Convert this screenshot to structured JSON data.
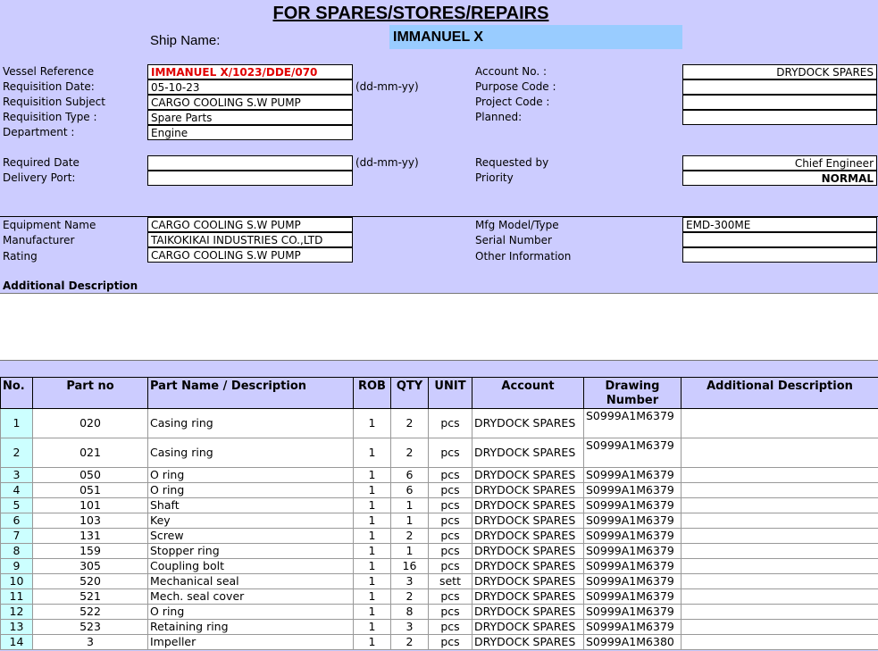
{
  "header": {
    "title": "FOR SPARES/STORES/REPAIRS",
    "ship_name_label": "Ship Name:",
    "ship_name": "IMMANUEL X"
  },
  "form": {
    "vessel_reference_label": "Vessel Reference",
    "vessel_reference": "IMMANUEL X/1023/DDE/070",
    "requisition_date_label": "Requisition Date:",
    "requisition_date": "05-10-23",
    "date_format_hint": "(dd-mm-yy)",
    "requisition_subject_label": "Requisition Subject",
    "requisition_subject": "CARGO COOLING S.W PUMP",
    "requisition_type_label": "Requisition Type :",
    "requisition_type": "Spare Parts",
    "department_label": "Department :",
    "department": "Engine",
    "account_no_label": "Account No. :",
    "account_no": "DRYDOCK SPARES",
    "purpose_code_label": "Purpose Code :",
    "purpose_code": "",
    "project_code_label": "Project Code :",
    "project_code": "",
    "planned_label": "Planned:",
    "planned": "",
    "required_date_label": "Required Date",
    "required_date": "",
    "required_date_hint": "(dd-mm-yy)",
    "delivery_port_label": "Delivery Port:",
    "delivery_port": "",
    "requested_by_label": "Requested by",
    "requested_by": "Chief Engineer",
    "priority_label": "Priority",
    "priority": "NORMAL"
  },
  "equipment": {
    "equipment_name_label": "Equipment Name",
    "equipment_name": "CARGO COOLING S.W PUMP",
    "manufacturer_label": "Manufacturer",
    "manufacturer": "TAIKOKIKAI INDUSTRIES CO.,LTD",
    "rating_label": "Rating",
    "rating": "CARGO COOLING S.W PUMP",
    "mfg_model_label": "Mfg Model/Type",
    "mfg_model": "EMD-300ME",
    "serial_number_label": "Serial Number",
    "serial_number": "",
    "other_information_label": "Other Information",
    "other_information": ""
  },
  "additional_description_label": "Additional Description",
  "additional_description": "",
  "table": {
    "headers": [
      "No.",
      "Part no",
      "Part Name / Description",
      "ROB",
      "QTY",
      "UNIT",
      "Account",
      "Drawing Number",
      "Additional Description"
    ],
    "rows": [
      {
        "no": "1",
        "part_no": "020",
        "name": "Casing ring",
        "rob": "1",
        "qty": "2",
        "unit": "pcs",
        "account": "DRYDOCK SPARES",
        "drawing": "S0999A1M6379",
        "desc": ""
      },
      {
        "no": "2",
        "part_no": "021",
        "name": "Casing ring",
        "rob": "1",
        "qty": "2",
        "unit": "pcs",
        "account": "DRYDOCK SPARES",
        "drawing": "S0999A1M6379",
        "desc": ""
      },
      {
        "no": "3",
        "part_no": "050",
        "name": "O ring",
        "rob": "1",
        "qty": "6",
        "unit": "pcs",
        "account": "DRYDOCK SPARES",
        "drawing": "S0999A1M6379",
        "desc": ""
      },
      {
        "no": "4",
        "part_no": "051",
        "name": "O ring",
        "rob": "1",
        "qty": "6",
        "unit": "pcs",
        "account": "DRYDOCK SPARES",
        "drawing": "S0999A1M6379",
        "desc": ""
      },
      {
        "no": "5",
        "part_no": "101",
        "name": "Shaft",
        "rob": "1",
        "qty": "1",
        "unit": "pcs",
        "account": "DRYDOCK SPARES",
        "drawing": "S0999A1M6379",
        "desc": ""
      },
      {
        "no": "6",
        "part_no": "103",
        "name": "Key",
        "rob": "1",
        "qty": "1",
        "unit": "pcs",
        "account": "DRYDOCK SPARES",
        "drawing": "S0999A1M6379",
        "desc": ""
      },
      {
        "no": "7",
        "part_no": "131",
        "name": "Screw",
        "rob": "1",
        "qty": "2",
        "unit": "pcs",
        "account": "DRYDOCK SPARES",
        "drawing": "S0999A1M6379",
        "desc": ""
      },
      {
        "no": "8",
        "part_no": "159",
        "name": "Stopper ring",
        "rob": "1",
        "qty": "1",
        "unit": "pcs",
        "account": "DRYDOCK SPARES",
        "drawing": "S0999A1M6379",
        "desc": ""
      },
      {
        "no": "9",
        "part_no": "305",
        "name": "Coupling bolt",
        "rob": "1",
        "qty": "16",
        "unit": "pcs",
        "account": "DRYDOCK SPARES",
        "drawing": "S0999A1M6379",
        "desc": ""
      },
      {
        "no": "10",
        "part_no": "520",
        "name": "Mechanical seal",
        "rob": "1",
        "qty": "3",
        "unit": "sett",
        "account": "DRYDOCK SPARES",
        "drawing": "S0999A1M6379",
        "desc": ""
      },
      {
        "no": "11",
        "part_no": "521",
        "name": "Mech. seal cover",
        "rob": "1",
        "qty": "2",
        "unit": "pcs",
        "account": "DRYDOCK SPARES",
        "drawing": "S0999A1M6379",
        "desc": ""
      },
      {
        "no": "12",
        "part_no": "522",
        "name": "O ring",
        "rob": "1",
        "qty": "8",
        "unit": "pcs",
        "account": "DRYDOCK SPARES",
        "drawing": "S0999A1M6379",
        "desc": ""
      },
      {
        "no": "13",
        "part_no": "523",
        "name": "Retaining ring",
        "rob": "1",
        "qty": "3",
        "unit": "pcs",
        "account": "DRYDOCK SPARES",
        "drawing": "S0999A1M6379",
        "desc": ""
      },
      {
        "no": "14",
        "part_no": "3",
        "name": "Impeller",
        "rob": "1",
        "qty": "2",
        "unit": "pcs",
        "account": "DRYDOCK SPARES",
        "drawing": "S0999A1M6380",
        "desc": ""
      }
    ]
  }
}
